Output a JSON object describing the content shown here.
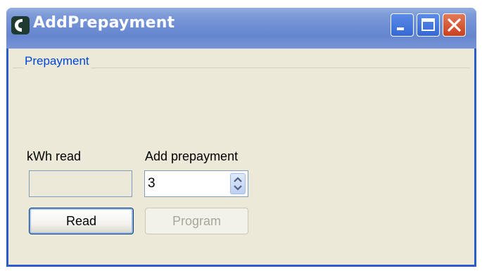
{
  "window": {
    "title": "AddPrepayment"
  },
  "group": {
    "label": "Prepayment"
  },
  "fields": {
    "kwh_label": "kWh read",
    "kwh_value": "",
    "add_label": "Add prepayment",
    "add_value": "3"
  },
  "buttons": {
    "read": "Read",
    "program": "Program"
  },
  "icons": {
    "app": "app-logo-icon",
    "minimize": "minimize-icon",
    "maximize": "maximize-icon",
    "close": "close-icon",
    "spin_up": "arrow-up-icon",
    "spin_down": "arrow-down-icon"
  },
  "colors": {
    "titlebar": "#6f8ed4",
    "window_bg": "#ece9d8",
    "group_label": "#0046d5",
    "close_button": "#c9401e",
    "disabled_text": "#a7a69b"
  }
}
